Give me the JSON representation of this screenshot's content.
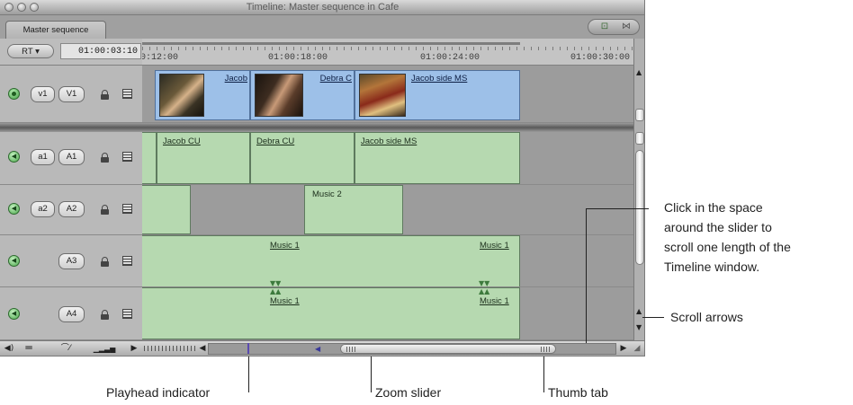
{
  "window": {
    "title": "Timeline: Master sequence in Cafe",
    "tab_label": "Master sequence"
  },
  "header": {
    "rt_label": "RT ▾",
    "timecode": "01:00:03:10"
  },
  "ruler": {
    "labels": [
      "0:12:00",
      "01:00:18:00",
      "01:00:24:00",
      "01:00:30:00"
    ]
  },
  "tracks": [
    {
      "source": "v1",
      "dest": "V1",
      "kind": "video"
    },
    {
      "source": "a1",
      "dest": "A1",
      "kind": "audio"
    },
    {
      "source": "a2",
      "dest": "A2",
      "kind": "audio"
    },
    {
      "source": "",
      "dest": "A3",
      "kind": "audio"
    },
    {
      "source": "",
      "dest": "A4",
      "kind": "audio"
    }
  ],
  "clips": {
    "v1": [
      "Jacob",
      "Debra C",
      "Jacob side MS"
    ],
    "a1": [
      "Jacob CU",
      "Debra CU",
      "Jacob side MS"
    ],
    "a2": [
      "Music 2"
    ],
    "a3": [
      "Music 1",
      "Music 1"
    ],
    "a4": [
      "Music 1",
      "Music 1"
    ]
  },
  "callouts": {
    "scroll_space": [
      "Click in the space",
      "around the slider to",
      "scroll one length of the",
      "Timeline window."
    ],
    "scroll_arrows": "Scroll arrows",
    "playhead": "Playhead indicator",
    "zoom": "Zoom slider",
    "thumb": "Thumb tab"
  },
  "colors": {
    "video_clip": "#9dc0e8",
    "audio_clip": "#b6d9b0",
    "track_bg": "#9c9c9c"
  }
}
